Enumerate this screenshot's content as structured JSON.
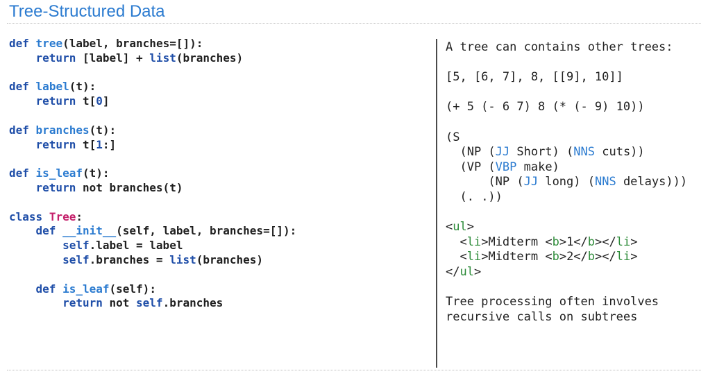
{
  "title": "Tree-Structured Data",
  "left_code": {
    "tree_def": {
      "kw": "def",
      "name": "tree",
      "sig": "(label, branches=[]):",
      "ret": "return",
      "body": " [label] + ",
      "list": "list",
      "tail": "(branches)"
    },
    "label_def": {
      "kw": "def",
      "name": "label",
      "sig": "(t):",
      "ret": "return",
      "body1": " t[",
      "idx": "0",
      "body2": "]"
    },
    "branches_def": {
      "kw": "def",
      "name": "branches",
      "sig": "(t):",
      "ret": "return",
      "body1": " t[",
      "idx": "1",
      "body2": ":]"
    },
    "is_leaf_def": {
      "kw": "def",
      "name": "is_leaf",
      "sig": "(t):",
      "ret": "return",
      "body": " not branches(t)"
    },
    "class_def": {
      "kw": "class",
      "name": "Tree",
      "colon": ":"
    },
    "init_def": {
      "kw": "def",
      "name": "__init__",
      "sig": "(self, label, branches=[]):",
      "line1_self": "self",
      "line1_rest": ".label = label",
      "line2_self": "self",
      "line2_mid": ".branches = ",
      "line2_list": "list",
      "line2_tail": "(branches)"
    },
    "method_is_leaf_def": {
      "kw": "def",
      "name": "is_leaf",
      "sig": "(self):",
      "ret": "return",
      "not": " not ",
      "self": "self",
      "tail": ".branches"
    }
  },
  "right_code": {
    "intro": "A tree can contains other trees:",
    "nested_list": "[5, [6, 7], 8, [[9], 10]]",
    "sexpr": "(+ 5 (- 6 7) 8 (* (- 9) 10))",
    "parse": {
      "open_s": "(S",
      "np_a": "(NP (",
      "jj_1": "JJ",
      "short": " Short) (",
      "nns_1": "NNS",
      "cuts": " cuts))",
      "vp_a": "(VP (",
      "vbp": "VBP",
      "make": " make)",
      "np_b": "(NP (",
      "jj_2": "JJ",
      "long": " long) (",
      "nns_2": "NNS",
      "delays": " delays)))",
      "period": "(. .))"
    },
    "html_snippet": {
      "ul_open_lt": "<",
      "ul_tag": "ul",
      "ul_open_gt": ">",
      "li1_lt": "<",
      "li_tag": "li",
      "li1_text": ">Midterm <",
      "b_tag": "b",
      "li1_num": ">1</",
      "li1_b_close": "b",
      "li1_mid": "></",
      "li1_li_close": "li",
      "li1_end": ">",
      "li2_text": ">Midterm <",
      "li2_num": ">2</",
      "li2_mid": "></",
      "li2_end": ">",
      "ul_close_lt": "</",
      "ul_close_gt": ">"
    },
    "outro_line1": "Tree processing often involves",
    "outro_line2": "recursive calls on subtrees"
  },
  "colors": {
    "title_blue": "#2b7bd0",
    "keyword_navy": "#1f4ea8",
    "class_name_magenta": "#c41f6a",
    "html_tag_green": "#2e8c3a"
  }
}
